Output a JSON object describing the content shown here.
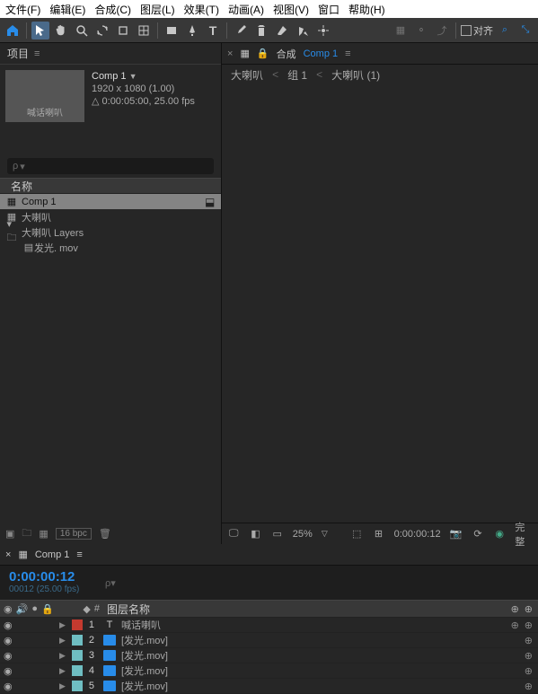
{
  "menu": [
    "文件(F)",
    "编辑(E)",
    "合成(C)",
    "图层(L)",
    "效果(T)",
    "动画(A)",
    "视图(V)",
    "窗口",
    "帮助(H)"
  ],
  "toolbar_align": "对齐",
  "panel": {
    "project": "项目"
  },
  "project": {
    "thumb_label": "喊话喇叭",
    "comp_name": "Comp 1",
    "resolution": "1920 x 1080 (1.00)",
    "duration": "△ 0:00:05:00, 25.00 fps",
    "search_placeholder": ""
  },
  "project_col": "名称",
  "project_items": [
    {
      "name": "Comp 1",
      "icon": "comp",
      "selected": true,
      "indent": 1,
      "flow": true
    },
    {
      "name": "大喇叭",
      "icon": "comp",
      "indent": 1
    },
    {
      "name": "大喇叭 Layers",
      "icon": "folder",
      "indent": 1,
      "expand": true
    },
    {
      "name": "发光. mov",
      "icon": "file",
      "indent": 2
    }
  ],
  "footer": {
    "bpc": "16 bpc"
  },
  "composition": {
    "label": "合成",
    "name": "Comp 1",
    "breadcrumb": [
      "大喇叭",
      "组 1",
      "大喇叭 (1)"
    ]
  },
  "viewer_footer": {
    "zoom": "25%",
    "time": "0:00:00:12",
    "res": "完整"
  },
  "timeline": {
    "tab": "Comp 1",
    "timecode": "0:00:00:12",
    "fps": "00012 (25.00 fps)",
    "col_label": "图层名称",
    "hash": "#",
    "layers": [
      {
        "num": "1",
        "swatch": "#c43a2f",
        "type": "T",
        "name": "喊话喇叭"
      },
      {
        "num": "2",
        "swatch": "#6fbec2",
        "type": "file",
        "name": "[发光.mov]"
      },
      {
        "num": "3",
        "swatch": "#6fbec2",
        "type": "file",
        "name": "[发光.mov]"
      },
      {
        "num": "4",
        "swatch": "#6fbec2",
        "type": "file",
        "name": "[发光.mov]"
      },
      {
        "num": "5",
        "swatch": "#6fbec2",
        "type": "file",
        "name": "[发光.mov]"
      }
    ]
  }
}
